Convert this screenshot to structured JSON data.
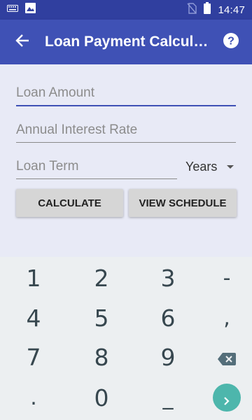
{
  "status_bar": {
    "time": "14:47",
    "left_icons": [
      "keyboard-icon",
      "image-icon"
    ],
    "right_icons": [
      "no-sim-icon",
      "battery-icon"
    ]
  },
  "app_bar": {
    "title": "Loan Payment Calcul…",
    "back_icon": "arrow-back-icon",
    "help_icon": "help-icon",
    "color": "#3f51b5"
  },
  "form": {
    "loan_amount_placeholder": "Loan Amount",
    "interest_rate_placeholder": "Annual Interest Rate",
    "loan_term_placeholder": "Loan Term",
    "term_unit": "Years",
    "calculate_label": "CALCULATE",
    "view_schedule_label": "VIEW SCHEDULE"
  },
  "keyboard": {
    "keys": [
      "1",
      "2",
      "3",
      "-",
      "4",
      "5",
      "6",
      ",",
      "7",
      "8",
      "9",
      ".",
      "0",
      "_"
    ],
    "backspace_icon": "backspace-icon",
    "go_icon": "chevron-right-icon",
    "go_color": "#4db6ac"
  }
}
